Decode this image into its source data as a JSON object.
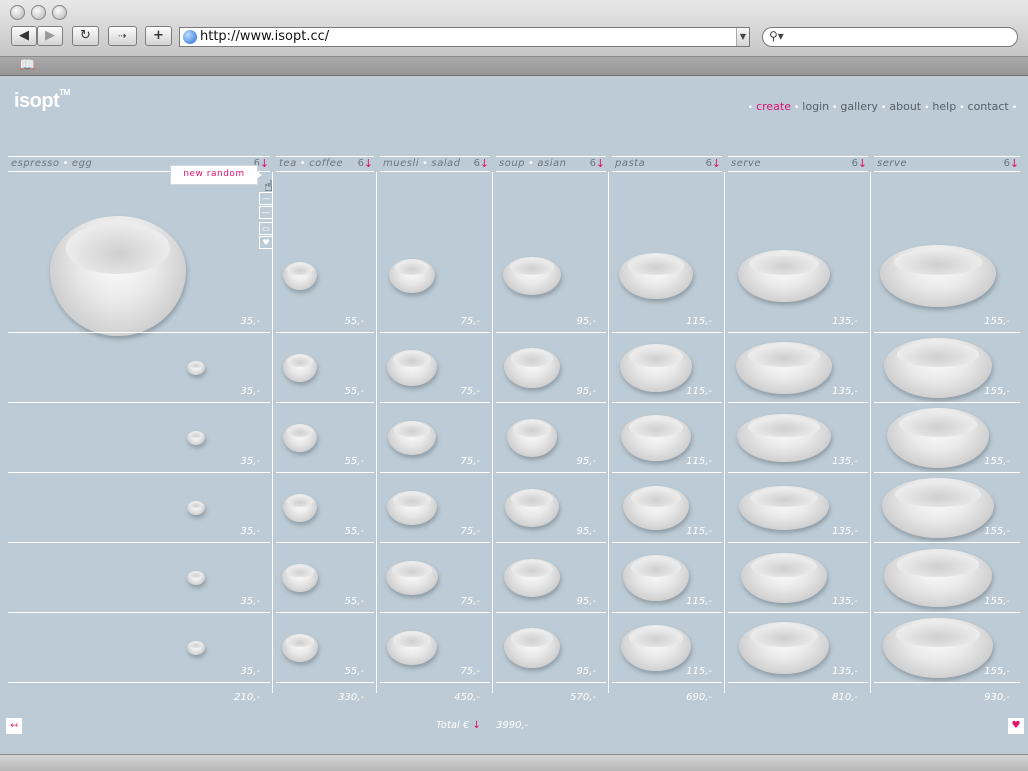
{
  "browser": {
    "url": "http://www.isopt.cc/",
    "back_icon": "back-arrow-icon",
    "forward_icon": "forward-arrow-icon",
    "reload_icon": "reload-icon",
    "add_icon": "plus-icon",
    "search_icon": "search-icon",
    "bookmarks_icon": "book-icon"
  },
  "site": {
    "logo": "isopt",
    "logo_tm": "TM",
    "nav": [
      {
        "label": "create",
        "active": true
      },
      {
        "label": "login",
        "active": false
      },
      {
        "label": "gallery",
        "active": false
      },
      {
        "label": "about",
        "active": false
      },
      {
        "label": "help",
        "active": false
      },
      {
        "label": "contact",
        "active": false
      }
    ]
  },
  "grid": {
    "columns": [
      {
        "name_a": "espresso",
        "name_b": "egg",
        "count": "6",
        "prices": [
          "35,-",
          "35,-",
          "35,-",
          "35,-",
          "35,-",
          "35,-"
        ],
        "total": "210,-"
      },
      {
        "name_a": "tea",
        "name_b": "coffee",
        "count": "6",
        "prices": [
          "55,-",
          "55,-",
          "55,-",
          "55,-",
          "55,-",
          "55,-"
        ],
        "total": "330,-"
      },
      {
        "name_a": "muesli",
        "name_b": "salad",
        "count": "6",
        "prices": [
          "75,-",
          "75,-",
          "75,-",
          "75,-",
          "75,-",
          "75,-"
        ],
        "total": "450,-"
      },
      {
        "name_a": "soup",
        "name_b": "asian",
        "count": "6",
        "prices": [
          "95,-",
          "95,-",
          "95,-",
          "95,-",
          "95,-",
          "95,-"
        ],
        "total": "570,-"
      },
      {
        "name_a": "pasta",
        "name_b": "",
        "count": "6",
        "prices": [
          "115,-",
          "115,-",
          "115,-",
          "115,-",
          "115,-",
          "115,-"
        ],
        "total": "690,-"
      },
      {
        "name_a": "serve",
        "name_b": "",
        "count": "6",
        "prices": [
          "135,-",
          "135,-",
          "135,-",
          "135,-",
          "135,-",
          "135,-"
        ],
        "total": "810,-"
      },
      {
        "name_a": "serve",
        "name_b": "",
        "count": "6",
        "prices": [
          "155,-",
          "155,-",
          "155,-",
          "155,-",
          "155,-",
          "155,-"
        ],
        "total": "930,-"
      }
    ],
    "down_arrow": "↓",
    "popup_label": "new random",
    "tools": [
      "—",
      "—",
      "▭",
      "♥"
    ]
  },
  "footer": {
    "total_label": "Total €",
    "total_arrow": "↓",
    "total_value": "3990,-",
    "left_icon_glyph": "↤",
    "right_icon_glyph": "♥"
  }
}
